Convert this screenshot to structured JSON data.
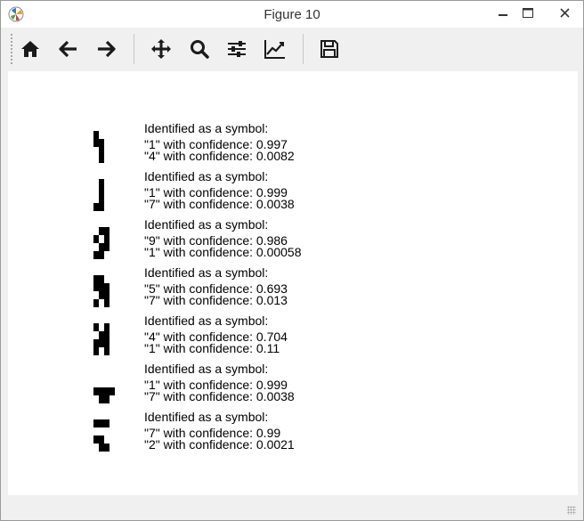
{
  "window": {
    "title": "Figure 10",
    "minimize_label": "─",
    "maximize_label": "☐",
    "close_label": "✕"
  },
  "toolbar": {
    "tools": [
      {
        "name": "home-icon",
        "tooltip": ""
      },
      {
        "name": "back-arrow-icon",
        "tooltip": ""
      },
      {
        "name": "forward-arrow-icon",
        "tooltip": ""
      },
      {
        "name": "pan-icon",
        "tooltip": ""
      },
      {
        "name": "zoom-icon",
        "tooltip": ""
      },
      {
        "name": "configure-subplots-icon",
        "tooltip": ""
      },
      {
        "name": "edit-axis-icon",
        "tooltip": ""
      },
      {
        "name": "save-icon",
        "tooltip": ""
      }
    ]
  },
  "results": [
    {
      "header": "Identified as a symbol:",
      "line1": "\"1\" with confidence: 0.997",
      "line2": "\"4\" with confidence: 0.0082",
      "pixels": [
        [
          1,
          0,
          0,
          0
        ],
        [
          1,
          1,
          0,
          0
        ],
        [
          0,
          1,
          0,
          0
        ],
        [
          0,
          1,
          0,
          0
        ]
      ]
    },
    {
      "header": "Identified as a symbol:",
      "line1": "\"1\" with confidence: 0.999",
      "line2": "\"7\" with confidence: 0.0038",
      "pixels": [
        [
          0,
          1,
          0,
          0
        ],
        [
          0,
          1,
          0,
          0
        ],
        [
          0,
          1,
          0,
          0
        ],
        [
          1,
          1,
          0,
          0
        ]
      ]
    },
    {
      "header": "Identified as a symbol:",
      "line1": "\"9\" with confidence: 0.986",
      "line2": "\"1\" with confidence: 0.00058",
      "pixels": [
        [
          0,
          1,
          1,
          0
        ],
        [
          1,
          0,
          1,
          0
        ],
        [
          0,
          1,
          1,
          0
        ],
        [
          1,
          1,
          0,
          0
        ]
      ]
    },
    {
      "header": "Identified as a symbol:",
      "line1": "\"5\" with confidence: 0.693",
      "line2": "\"7\" with confidence: 0.013",
      "pixels": [
        [
          1,
          1,
          0,
          0
        ],
        [
          1,
          1,
          1,
          0
        ],
        [
          0,
          1,
          1,
          0
        ],
        [
          1,
          0,
          1,
          0
        ]
      ]
    },
    {
      "header": "Identified as a symbol:",
      "line1": "\"4\" with confidence: 0.704",
      "line2": "\"1\" with confidence: 0.11",
      "pixels": [
        [
          1,
          0,
          1,
          0
        ],
        [
          0,
          1,
          1,
          0
        ],
        [
          1,
          1,
          1,
          0
        ],
        [
          1,
          0,
          1,
          0
        ]
      ]
    },
    {
      "header": "Identified as a symbol:",
      "line1": "\"1\" with confidence: 0.999",
      "line2": "\"7\" with confidence: 0.0038",
      "pixels": [
        [
          0,
          0,
          0,
          0
        ],
        [
          0,
          0,
          0,
          0
        ],
        [
          1,
          1,
          1,
          1
        ],
        [
          0,
          1,
          1,
          0
        ]
      ]
    },
    {
      "header": "Identified as a symbol:",
      "line1": "\"7\" with confidence: 0.99",
      "line2": "\"2\" with confidence: 0.0021",
      "pixels": [
        [
          1,
          1,
          1,
          0
        ],
        [
          0,
          0,
          0,
          0
        ],
        [
          1,
          1,
          0,
          0
        ],
        [
          0,
          1,
          1,
          0
        ]
      ]
    }
  ]
}
